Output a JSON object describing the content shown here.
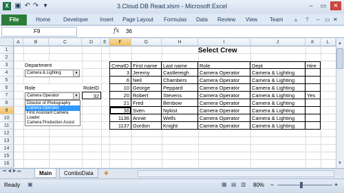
{
  "window": {
    "title": "3.Cloud DB Read.xlsm - Microsoft Excel"
  },
  "qat": {
    "icons": [
      "excel-icon",
      "save-icon",
      "undo-icon",
      "redo-icon",
      "customize-icon"
    ]
  },
  "ribbon": {
    "file": "File",
    "tabs": [
      "Home",
      "Developer",
      "Insert",
      "Page Layout",
      "Formulas",
      "Data",
      "Review",
      "View",
      "Team"
    ]
  },
  "formula": {
    "name_box": "F9",
    "fx": "fx",
    "value": "36"
  },
  "columns": [
    "A",
    "B",
    "C",
    "D",
    "E",
    "F",
    "G",
    "H",
    "I",
    "J",
    "K",
    "L"
  ],
  "rows": [
    "1",
    "2",
    "3",
    "4",
    "5",
    "6",
    "7",
    "8",
    "9",
    "10",
    "11",
    "12",
    "13",
    "14",
    "15",
    "16"
  ],
  "form": {
    "department_label": "Department",
    "department_value": "Camera & Lighting",
    "role_label": "Role",
    "role_value": "Camera Operator",
    "roleid_label": "RoleID",
    "roleid_value": "32",
    "role_options": [
      "Director of Photography",
      "Camera Operator",
      "First Assistant Camera",
      "Loader",
      "Camera Production Assist"
    ]
  },
  "crew": {
    "title": "Select Crew",
    "headers": [
      "CrewID",
      "First name",
      "Last name",
      "Role",
      "Dept",
      "Hire"
    ],
    "rows": [
      [
        "3",
        "Jeremy",
        "Castlereigh",
        "Camera Operator",
        "Camera & Lighting",
        ""
      ],
      [
        "6",
        "Neil",
        "Chambers",
        "Camera Operator",
        "Camera & Lighting",
        ""
      ],
      [
        "10",
        "George",
        "Peppard",
        "Camera Operator",
        "Camera & Lighting",
        ""
      ],
      [
        "20",
        "Robert",
        "Stevens",
        "Camera Operator",
        "Camera & Lighting",
        "Yes"
      ],
      [
        "21",
        "Fred",
        "Benbow",
        "Camera Operator",
        "Camera & Lighting",
        ""
      ],
      [
        "36",
        "Sven",
        "Nykist",
        "Camera Operator",
        "Camera & Lighting",
        ""
      ],
      [
        "1136",
        "Annie",
        "Wells",
        "Camera Operator",
        "Camera & Lighting",
        ""
      ],
      [
        "1137",
        "Gordon",
        "Knight",
        "Camera Operator",
        "Camera & Lighting",
        ""
      ]
    ]
  },
  "sheets": {
    "tabs": [
      "Main",
      "ComboData"
    ],
    "active": "Main"
  },
  "status": {
    "text": "Ready",
    "zoom": "80%",
    "minus": "−",
    "plus": "+"
  },
  "colors": {
    "file_tab": "#2d7d3a",
    "selection": "#3399ff",
    "header_selected": "#f1c15f"
  }
}
